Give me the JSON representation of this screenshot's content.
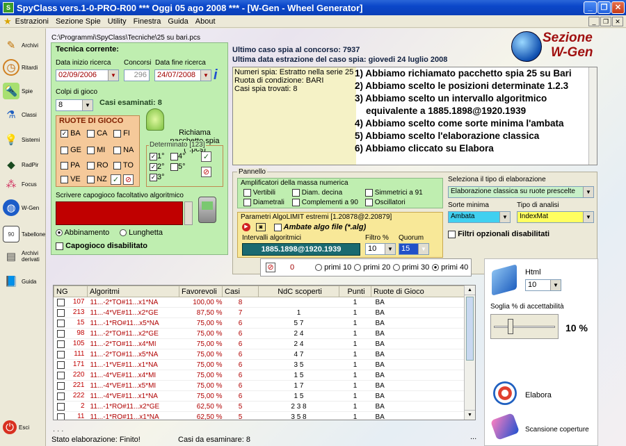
{
  "window": {
    "title": "SpyClass vers.1-0-PRO-R00  ***  Oggi 05 ago 2008  ***   - [W-Gen - Wheel Generator]"
  },
  "menu": [
    "Estrazioni",
    "Sezione Spie",
    "Utility",
    "Finestra",
    "Guida",
    "About"
  ],
  "sidebar": [
    {
      "label": "Archivi",
      "icon": "pencil-icon"
    },
    {
      "label": "Ritardi",
      "icon": "clock-icon"
    },
    {
      "label": "Spie",
      "icon": "flashlight-icon"
    },
    {
      "label": "Classi",
      "icon": "flask-icon"
    },
    {
      "label": "Sistemi",
      "icon": "lightbulb-icon"
    },
    {
      "label": "RadPir",
      "icon": "pyramid-icon"
    },
    {
      "label": "Focus",
      "icon": "balls-icon"
    },
    {
      "label": "W-Gen",
      "icon": "globe-icon"
    },
    {
      "label": "Tabellone",
      "icon": "board-icon"
    },
    {
      "label": "Archivi derivati",
      "icon": "archive-icon"
    },
    {
      "label": "Guida",
      "icon": "book-icon"
    },
    {
      "label": "Esci",
      "icon": "exit-icon"
    }
  ],
  "path": "C:\\Programmi\\SpyClass\\Tecniche\\25 su bari.pcs",
  "tecnica": {
    "title": "Tecnica corrente:",
    "data_inizio_label": "Data inizio ricerca",
    "data_inizio": "02/09/2006",
    "concorsi_label": "Concorsi",
    "concorsi": "296",
    "data_fine_label": "Data fine ricerca",
    "data_fine": "24/07/2008",
    "colpi_label": "Colpi di gioco",
    "colpi": "8",
    "casi_esaminati": "Casi esaminati: 8",
    "ruote_title": "RUOTE DI GIOCO",
    "ruote": [
      [
        "BA",
        "CA",
        "FI"
      ],
      [
        "GE",
        "MI",
        "NA"
      ],
      [
        "PA",
        "RO",
        "TO"
      ],
      [
        "VE",
        "NZ"
      ]
    ],
    "richiama": "Richiama pacchetto spia (*.pcs)",
    "determinato_title": "Determinato [123]",
    "determinato": [
      "1°",
      "2°",
      "3°",
      "4°",
      "5°"
    ],
    "capogioco_label": "Scrivere capogioco facoltativo algoritmico",
    "abbinamento": "Abbinamento",
    "lunghetta": "Lunghetta",
    "capogioco_disabilitato": "Capogioco disabilitato"
  },
  "header": {
    "sezione1": "Sezione",
    "sezione2": "W-Gen",
    "ultimo_caso": "Ultimo caso spia al concorso: 7937",
    "ultima_data": "Ultima data estrazione del caso spia: giovedi 24 luglio 2008"
  },
  "info": [
    "Numeri spia: Estratto nella serie 25",
    "Ruota di condizione: BARI",
    "Casi spia trovati: 8"
  ],
  "instructions": [
    "1) Abbiamo richiamato pacchetto spia 25 su Bari",
    "2) Abbiamo scelto le posizioni determinate 1.2.3",
    "3) Abbiamo scelto un intervallo algoritmico",
    "    equivalente a 1885.1898@1920.1939",
    "4) Abbiamo scelto come sorte minima l'ambata",
    "5) Abbiamo scelto l'elaborazione classica",
    "6) Abbiamo cliccato su Elabora"
  ],
  "pannello": {
    "title": "Pannello",
    "ampl_title": "Amplificatori della massa numerica",
    "ampl": [
      "Vertibili",
      "Diam. decina",
      "Simmetrici a 91",
      "Diametrali",
      "Complementi a 90",
      "Oscillatori"
    ],
    "param_title": "Parametri AlgoLIMIT estremi [1.20878@2.20879]",
    "ambate_algo": "Ambate algo file (*.alg)",
    "intervalli_label": "Intervalli algoritmici",
    "intervalli": "1885.1898@1920.1939",
    "filtro_label": "Filtro %",
    "filtro": "10",
    "quorum_label": "Quorum",
    "quorum": "15",
    "tipo_label": "Seleziona il tipo di elaborazione",
    "tipo": "Elaborazione classica su ruote prescelte",
    "sorte_label": "Sorte minima",
    "sorte": "Ambata",
    "analisi_label": "Tipo di analisi",
    "analisi": "IndexMat",
    "filtri_opz": "Filtri opzionali disabilitati"
  },
  "filterbar": {
    "count": "0",
    "options": [
      "primi 10",
      "primi 20",
      "primi 30",
      "primi 40"
    ]
  },
  "grid": {
    "columns": [
      "NG",
      "Algoritmi",
      "Favorevoli",
      "Casi",
      "NdC scoperti",
      "Punti",
      "Ruote di Gioco"
    ],
    "rows": [
      [
        "107",
        "11...-2*TO#11...x1*NA",
        "100,00 %",
        "8",
        "",
        "1",
        "BA"
      ],
      [
        "213",
        "11...-4*VE#11...x2*GE",
        "87,50 %",
        "7",
        "1",
        "1",
        "BA"
      ],
      [
        "15",
        "11...-1*RO#11...x5*NA",
        "75,00 %",
        "6",
        "5 7",
        "1",
        "BA"
      ],
      [
        "98",
        "11...-2*TO#11...x2*GE",
        "75,00 %",
        "6",
        "2 4",
        "1",
        "BA"
      ],
      [
        "105",
        "11...-2*TO#11...x4*MI",
        "75,00 %",
        "6",
        "2 4",
        "1",
        "BA"
      ],
      [
        "111",
        "11...-2*TO#11...x5*NA",
        "75,00 %",
        "6",
        "4 7",
        "1",
        "BA"
      ],
      [
        "171",
        "11...-1*VE#11...x1*NA",
        "75,00 %",
        "6",
        "3 5",
        "1",
        "BA"
      ],
      [
        "220",
        "11...-4*VE#11...x4*MI",
        "75,00 %",
        "6",
        "1 5",
        "1",
        "BA"
      ],
      [
        "221",
        "11...-4*VE#11...x5*MI",
        "75,00 %",
        "6",
        "1 7",
        "1",
        "BA"
      ],
      [
        "222",
        "11...-4*VE#11...x1*NA",
        "75,00 %",
        "6",
        "1 5",
        "1",
        "BA"
      ],
      [
        "2",
        "11...-1*RO#11...x2*GE",
        "62,50 %",
        "5",
        "2 3 8",
        "1",
        "BA"
      ],
      [
        "11",
        "11...-1*RO#11...x1*NA",
        "62,50 %",
        "5",
        "3 5 8",
        "1",
        "BA"
      ]
    ]
  },
  "right": {
    "html_label": "Html",
    "html": "10",
    "soglia_label": "Soglia % di accettabilità",
    "soglia": "10 %",
    "elabora": "Elabora",
    "scansione": "Scansione coperture"
  },
  "status": {
    "dots": ". . .",
    "stato": "Stato elaborazione: Finito!",
    "casi": "Casi da esaminare: 8",
    "more": "..."
  }
}
